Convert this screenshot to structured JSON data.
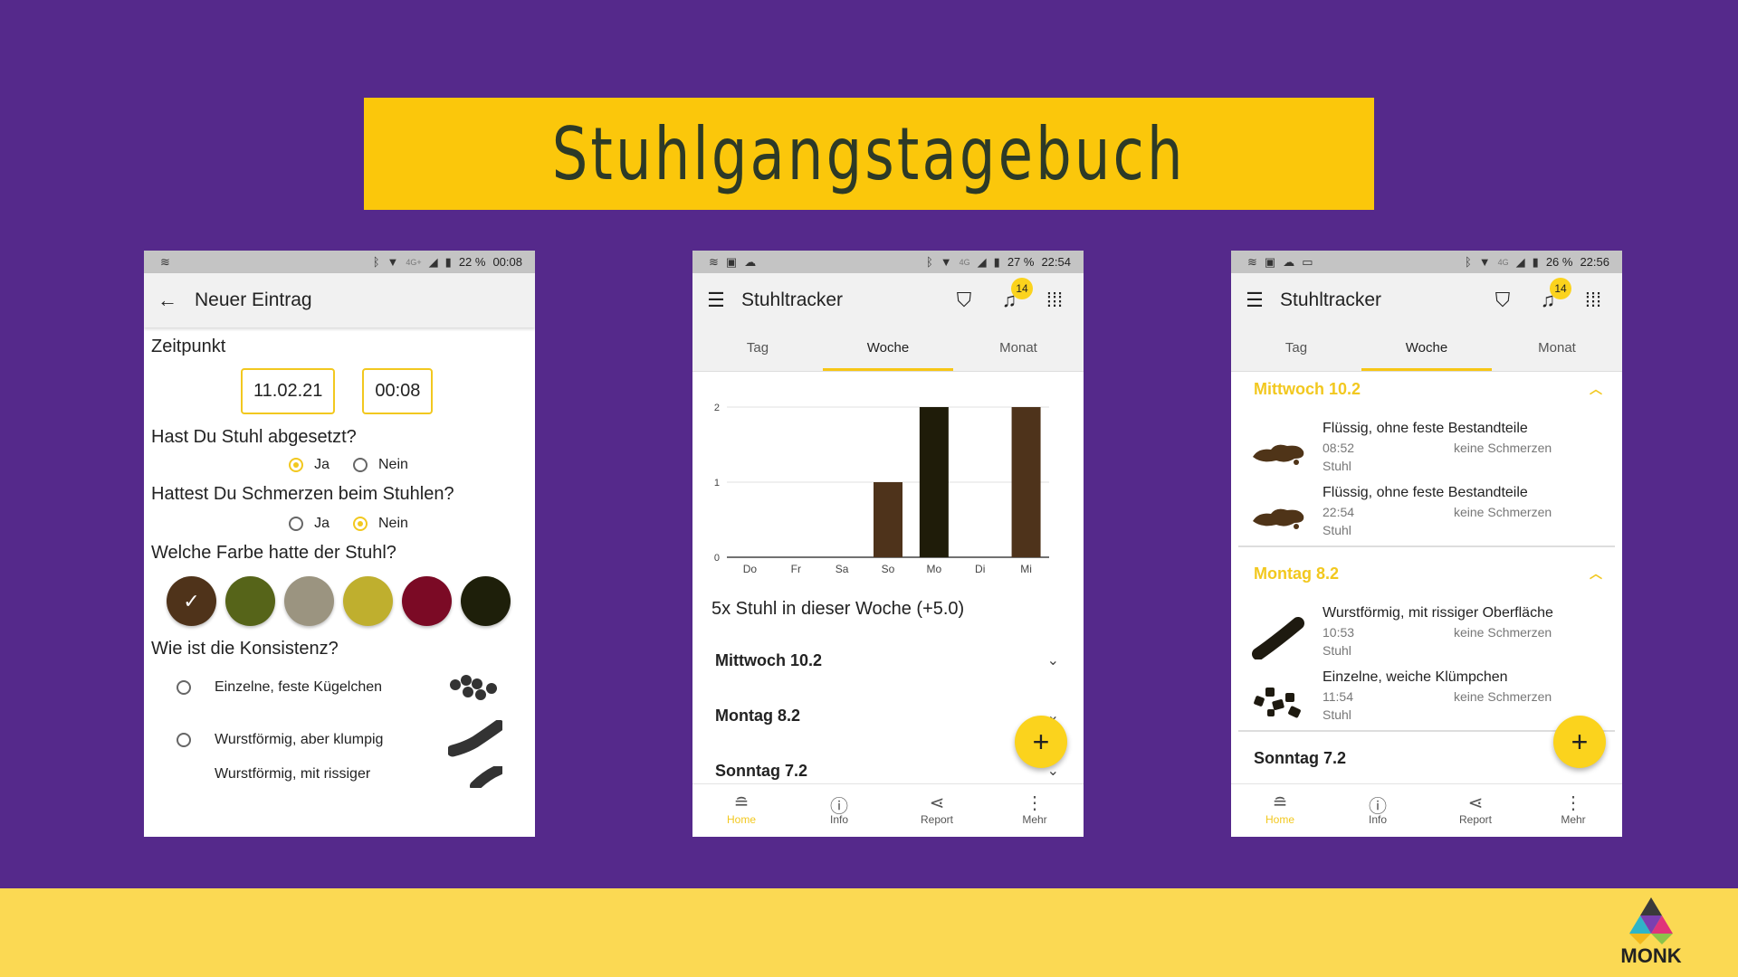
{
  "banner": {
    "title": "Stuhlgangstagebuch"
  },
  "logo": {
    "text": "MONK"
  },
  "phones": [
    {
      "status": {
        "battery": "22 %",
        "time": "00:08",
        "network": "4G+"
      },
      "appbar": {
        "title": "Neuer Eintrag",
        "back_icon": "arrow-back-icon"
      },
      "form": {
        "zeitpunkt_label": "Zeitpunkt",
        "date": "11.02.21",
        "time": "00:08",
        "q1": "Hast Du Stuhl abgesetzt?",
        "q1_yes": "Ja",
        "q1_no": "Nein",
        "q1_selected": "Ja",
        "q2": "Hattest Du Schmerzen beim Stuhlen?",
        "q2_yes": "Ja",
        "q2_no": "Nein",
        "q2_selected": "Nein",
        "q3": "Welche Farbe hatte der Stuhl?",
        "colors": [
          "#4f331a",
          "#566419",
          "#9b9480",
          "#bfaf2e",
          "#7b0a25",
          "#1e1f0a"
        ],
        "selected_color_index": 0,
        "q4": "Wie ist die Konsistenz?",
        "consistency": [
          "Einzelne, feste Kügelchen",
          "Wurstförmig, aber klumpig",
          "Wurstförmig, mit rissiger"
        ]
      }
    },
    {
      "status": {
        "battery": "27 %",
        "time": "22:54",
        "network": "4G"
      },
      "appbar": {
        "title": "Stuhltracker",
        "badge": "14"
      },
      "tabs": [
        "Tag",
        "Woche",
        "Monat"
      ],
      "active_tab": "Woche",
      "summary": "5x Stuhl in dieser Woche (+5.0)",
      "days": [
        "Mittwoch 10.2",
        "Montag 8.2",
        "Sonntag 7.2"
      ],
      "nav": [
        "Home",
        "Info",
        "Report",
        "Mehr"
      ]
    },
    {
      "status": {
        "battery": "26 %",
        "time": "22:56",
        "network": "4G"
      },
      "appbar": {
        "title": "Stuhltracker",
        "badge": "14"
      },
      "tabs": [
        "Tag",
        "Woche",
        "Monat"
      ],
      "active_tab": "Woche",
      "groups": [
        {
          "title": "Mittwoch 10.2",
          "entries": [
            {
              "title": "Flüssig, ohne feste Bestandteile",
              "time": "08:52",
              "pain": "keine Schmerzen",
              "kind": "Stuhl"
            },
            {
              "title": "Flüssig, ohne feste Bestandteile",
              "time": "22:54",
              "pain": "keine Schmerzen",
              "kind": "Stuhl"
            }
          ]
        },
        {
          "title": "Montag 8.2",
          "entries": [
            {
              "title": "Wurstförmig, mit rissiger Oberfläche",
              "time": "10:53",
              "pain": "keine Schmerzen",
              "kind": "Stuhl"
            },
            {
              "title": "Einzelne, weiche Klümpchen",
              "time": "11:54",
              "pain": "keine Schmerzen",
              "kind": "Stuhl"
            }
          ]
        },
        {
          "title": "Sonntag 7.2",
          "entries": []
        }
      ],
      "nav": [
        "Home",
        "Info",
        "Report",
        "Mehr"
      ]
    }
  ],
  "chart_data": {
    "type": "bar",
    "categories": [
      "Do",
      "Fr",
      "Sa",
      "So",
      "Mo",
      "Di",
      "Mi"
    ],
    "values": [
      0,
      0,
      0,
      1,
      2,
      0,
      2
    ],
    "bar_colors": [
      "#4e331b",
      "#4e331b",
      "#4e331b",
      "#4e331b",
      "#1f1c09",
      "#4e331b",
      "#4e331b"
    ],
    "yticks": [
      0,
      1,
      2
    ],
    "ylim": [
      0,
      2
    ],
    "grid": true
  }
}
